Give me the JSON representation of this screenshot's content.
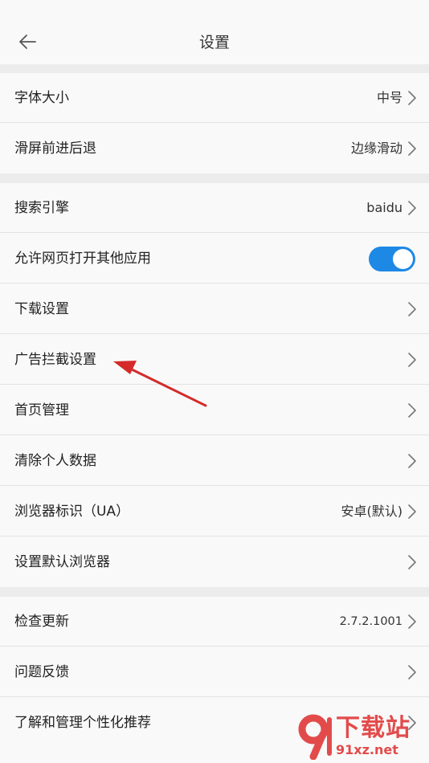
{
  "header": {
    "title": "设置"
  },
  "groups": [
    {
      "items": [
        {
          "label": "字体大小",
          "value": "中号"
        },
        {
          "label": "滑屏前进后退",
          "value": "边缘滑动"
        }
      ]
    },
    {
      "items": [
        {
          "label": "搜索引擎",
          "value": "baidu"
        },
        {
          "label": "允许网页打开其他应用",
          "toggle_on": true
        },
        {
          "label": "下载设置"
        },
        {
          "label": "广告拦截设置"
        },
        {
          "label": "首页管理"
        },
        {
          "label": "清除个人数据"
        },
        {
          "label": "浏览器标识（UA）",
          "value": "安卓(默认)"
        },
        {
          "label": "设置默认浏览器"
        }
      ]
    },
    {
      "items": [
        {
          "label": "检查更新",
          "value": "2.7.2.1001"
        },
        {
          "label": "问题反馈"
        },
        {
          "label": "了解和管理个性化推荐"
        }
      ]
    }
  ],
  "colors": {
    "toggle_on": "#1e88e5",
    "annotation_arrow": "#d42a2a",
    "watermark": "#e34b4b"
  },
  "watermark": {
    "text": "下载站",
    "url": "91xz.net"
  }
}
